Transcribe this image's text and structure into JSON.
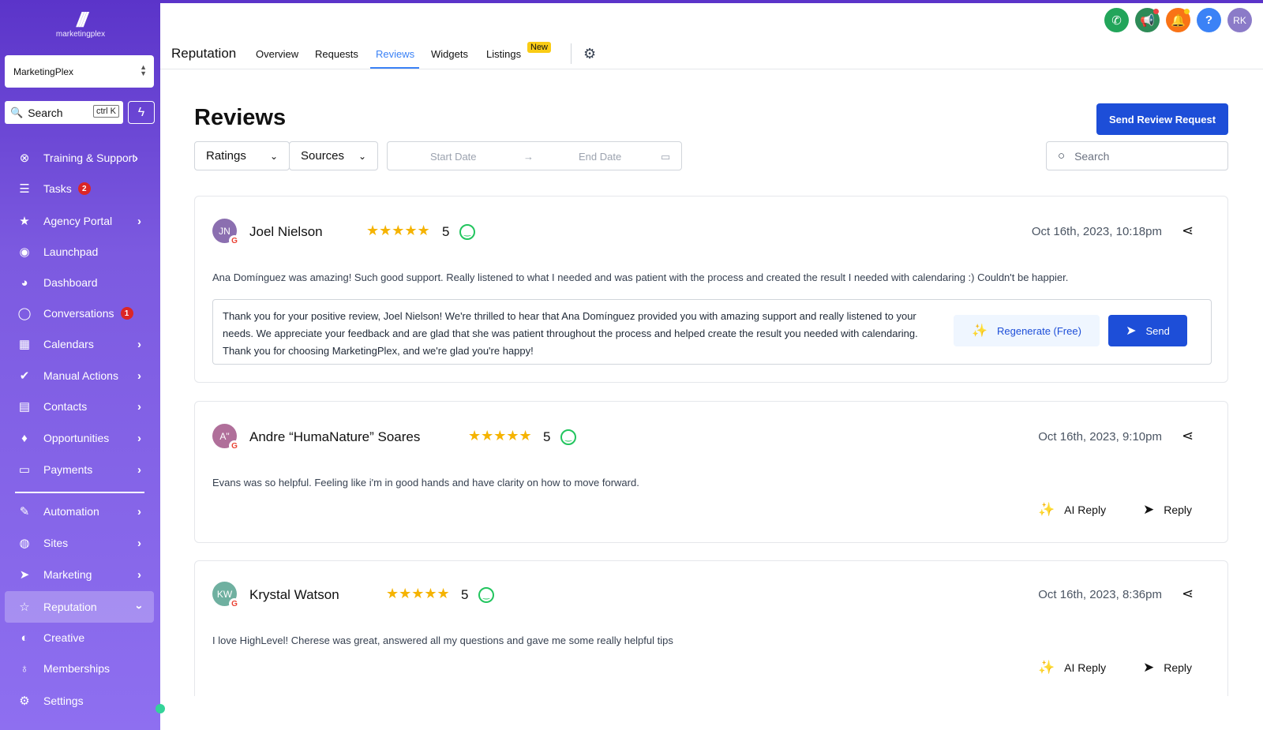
{
  "sidebar": {
    "logo_text": "marketingplex",
    "account": "MarketingPlex",
    "search_label": "Search",
    "search_shortcut": "ctrl K",
    "items": [
      {
        "label": "Training & Support",
        "icon": "support-icon"
      },
      {
        "label": "Tasks",
        "icon": "tasks-icon",
        "badge": "2"
      },
      {
        "label": "Agency Portal",
        "icon": "star-icon"
      },
      {
        "label": "Launchpad",
        "icon": "rocket-icon"
      },
      {
        "label": "Dashboard",
        "icon": "dashboard-icon"
      },
      {
        "label": "Conversations",
        "icon": "chat-icon",
        "badge": "1"
      },
      {
        "label": "Calendars",
        "icon": "calendar-icon"
      },
      {
        "label": "Manual Actions",
        "icon": "check-icon"
      },
      {
        "label": "Contacts",
        "icon": "contacts-icon"
      },
      {
        "label": "Opportunities",
        "icon": "opportunities-icon"
      },
      {
        "label": "Payments",
        "icon": "payments-icon"
      },
      {
        "label": "Automation",
        "icon": "automation-icon"
      },
      {
        "label": "Sites",
        "icon": "globe-icon"
      },
      {
        "label": "Marketing",
        "icon": "send-icon"
      },
      {
        "label": "Reputation",
        "icon": "star-outline-icon"
      },
      {
        "label": "Creative",
        "icon": "palette-icon"
      },
      {
        "label": "Memberships",
        "icon": "badge-icon"
      },
      {
        "label": "Settings",
        "icon": "gear-icon"
      }
    ]
  },
  "header": {
    "title": "Reputation",
    "tabs": [
      "Overview",
      "Requests",
      "Reviews",
      "Widgets",
      "Listings"
    ],
    "active_tab": "Reviews",
    "new_badge": "New",
    "user_initials": "RK"
  },
  "main": {
    "title": "Reviews",
    "send_request_label": "Send Review Request",
    "filters": {
      "ratings": "Ratings",
      "sources": "Sources",
      "start_date": "Start Date",
      "end_date": "End Date"
    },
    "search_placeholder": "Search"
  },
  "reviews": [
    {
      "initials": "JN",
      "name": "Joel Nielson",
      "rating": "5",
      "date": "Oct 16th, 2023, 10:18pm",
      "text": "Ana Domínguez was amazing! Such good support. Really listened to what I needed and was patient with the process and created the result I needed with calendaring :) Couldn't be happier.",
      "reply_draft": "Thank you for your positive review, Joel Nielson! We're thrilled to hear that Ana Domínguez provided you with amazing support and really listened to your needs. We appreciate your feedback and are glad that she was patient throughout the process and helped create the result you needed with calendaring. Thank you for choosing MarketingPlex, and we're glad you're happy!",
      "regenerate_label": "Regenerate (Free)",
      "send_label": "Send",
      "avatar_color": "#8b6fb0"
    },
    {
      "initials": "A\"",
      "name": "Andre “HumaNature” Soares",
      "rating": "5",
      "date": "Oct 16th, 2023, 9:10pm",
      "text": "Evans was so helpful. Feeling like i'm in good hands and have clarity on how to move forward.",
      "ai_reply_label": "AI Reply",
      "reply_label": "Reply",
      "avatar_color": "#b06f9a"
    },
    {
      "initials": "KW",
      "name": "Krystal Watson",
      "rating": "5",
      "date": "Oct 16th, 2023, 8:36pm",
      "text": "I love HighLevel! Cherese was great, answered all my questions and gave me some really helpful tips",
      "ai_reply_label": "AI Reply",
      "reply_label": "Reply",
      "avatar_color": "#6fb0a0"
    }
  ]
}
